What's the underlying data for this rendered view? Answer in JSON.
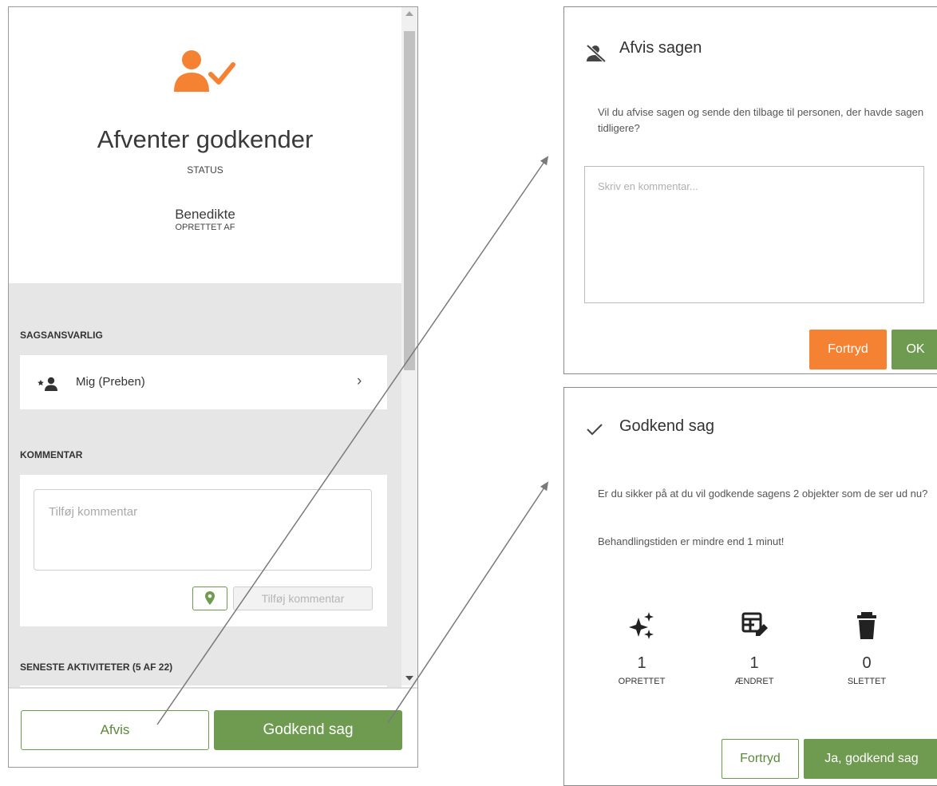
{
  "side_panel": {
    "status": {
      "title": "Afventer godkender",
      "label": "STATUS"
    },
    "creator": {
      "name": "Benedikte",
      "label": "OPRETTET AF"
    },
    "responsible": {
      "heading": "SAGSANSVARLIG",
      "value": "Mig (Preben)"
    },
    "comment": {
      "heading": "KOMMENTAR",
      "placeholder": "Tilføj kommentar",
      "add_button": "Tilføj kommentar"
    },
    "activities": {
      "heading": "SENESTE AKTIVITETER (5 AF 22)"
    },
    "footer": {
      "reject_button": "Afvis",
      "approve_button": "Godkend sag"
    }
  },
  "reject_dialog": {
    "title": "Afvis sagen",
    "question": "Vil du afvise sagen og sende den tilbage til personen, der havde sagen tidligere?",
    "comment_placeholder": "Skriv en kommentar...",
    "cancel_button": "Fortryd",
    "ok_button": "OK"
  },
  "approve_dialog": {
    "title": "Godkend sag",
    "question": "Er du sikker på at du vil godkende sagens 2 objekter som de ser ud nu?",
    "processing_time": "Behandlingstiden er mindre end 1 minut!",
    "stats": [
      {
        "icon": "sparkle-icon",
        "count": "1",
        "label": "OPRETTET"
      },
      {
        "icon": "table-edit-icon",
        "count": "1",
        "label": "ÆNDRET"
      },
      {
        "icon": "trash-icon",
        "count": "0",
        "label": "SLETTET"
      }
    ],
    "cancel_button": "Fortryd",
    "confirm_button": "Ja, godkend sag"
  },
  "colors": {
    "accent_orange": "#f58233",
    "primary_green": "#6e9b4f",
    "panel_grey": "#e6e6e6"
  }
}
